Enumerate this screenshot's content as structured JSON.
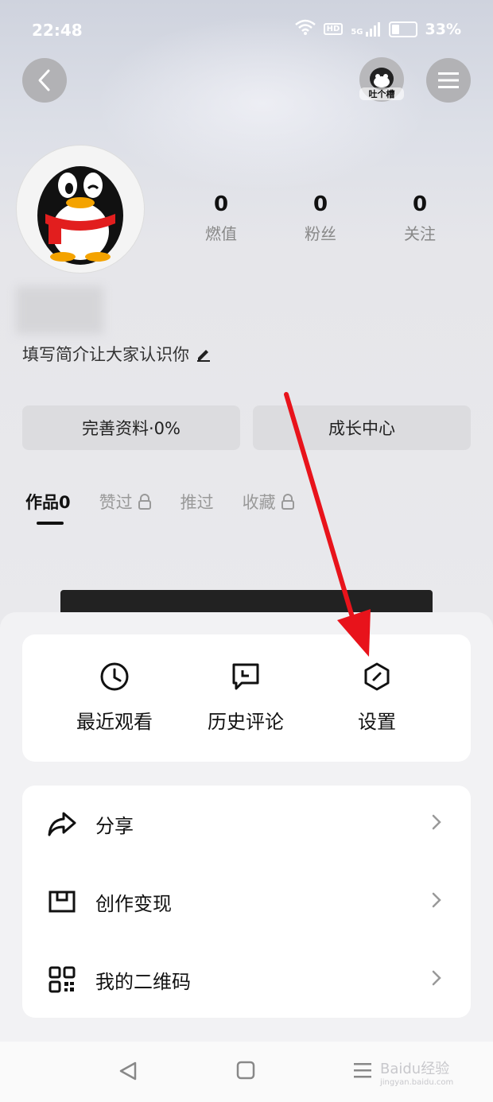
{
  "status_bar": {
    "time": "22:48",
    "network": "5G",
    "hd": "HD",
    "battery": "33%"
  },
  "header": {
    "mascot_label": "吐个槽"
  },
  "stats": [
    {
      "value": "0",
      "label": "燃值"
    },
    {
      "value": "0",
      "label": "粉丝"
    },
    {
      "value": "0",
      "label": "关注"
    }
  ],
  "profile": {
    "bio": "填写简介让大家认识你"
  },
  "buttons": {
    "complete_profile": "完善资料·0%",
    "growth_center": "成长中心"
  },
  "tabs": [
    {
      "label": "作品0",
      "locked": false
    },
    {
      "label": "赞过",
      "locked": true
    },
    {
      "label": "推过",
      "locked": false
    },
    {
      "label": "收藏",
      "locked": true
    }
  ],
  "quick_actions": [
    {
      "label": "最近观看",
      "icon": "clock-icon"
    },
    {
      "label": "历史评论",
      "icon": "comment-icon"
    },
    {
      "label": "设置",
      "icon": "settings-icon"
    }
  ],
  "menu": [
    {
      "label": "分享",
      "icon": "share-icon"
    },
    {
      "label": "创作变现",
      "icon": "monetize-icon"
    },
    {
      "label": "我的二维码",
      "icon": "qr-code-icon"
    }
  ],
  "watermark": {
    "text": "Baidu经验",
    "sub": "jingyan.baidu.com"
  },
  "colors": {
    "arrow": "#e8131b",
    "sheet_bg": "#f2f2f4",
    "card_bg": "#ffffff"
  }
}
